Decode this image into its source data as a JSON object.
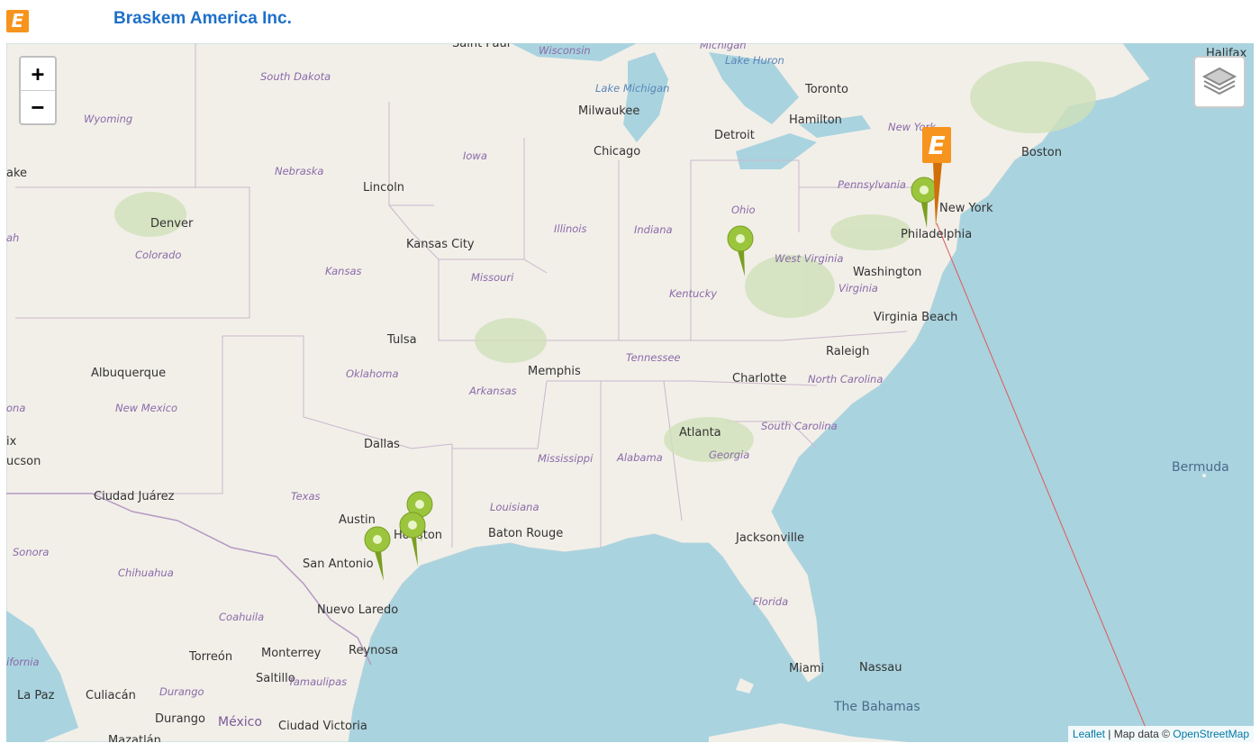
{
  "header": {
    "logo_letter": "E",
    "title": "Braskem America Inc."
  },
  "map": {
    "zoom_in": "+",
    "zoom_out": "−",
    "attribution": {
      "leaflet": "Leaflet",
      "separator": " | Map data © ",
      "osm": "OpenStreetMap"
    },
    "cities": [
      "Saint Paul",
      "Milwaukee",
      "Toronto",
      "Hamilton",
      "Detroit",
      "Chicago",
      "Halifax",
      "Boston",
      "New York",
      "Philadelphia",
      "Washington",
      "Virginia Beach",
      "Raleigh",
      "Charlotte",
      "Atlanta",
      "Jacksonville",
      "Miami",
      "Nassau",
      "Memphis",
      "Tulsa",
      "Kansas City",
      "Lincoln",
      "Denver",
      "Albuquerque",
      "Dallas",
      "Austin",
      "San Antonio",
      "Houston",
      "Baton Rouge",
      "Ciudad Juárez",
      "ucson",
      "ix",
      "ake",
      "Nuevo Laredo",
      "Reynosa",
      "Monterrey",
      "Saltillo",
      "Torreón",
      "Durango",
      "Culiacán",
      "La Paz",
      "Ciudad Victoria",
      "Mazatlán"
    ],
    "states": [
      "Wisconsin",
      "Michigan",
      "South Dakota",
      "Wyoming",
      "Nebraska",
      "Iowa",
      "Illinois",
      "Indiana",
      "Ohio",
      "Pennsylvania",
      "New York",
      "West Virginia",
      "Virginia",
      "Kentucky",
      "Colorado",
      "Kansas",
      "Missouri",
      "Oklahoma",
      "Tennessee",
      "Arkansas",
      "North Carolina",
      "South Carolina",
      "Georgia",
      "Alabama",
      "Mississippi",
      "Louisiana",
      "Texas",
      "New Mexico",
      "Florida",
      "Sonora",
      "Chihuahua",
      "Coahuila",
      "Durango",
      "Tamaulipas",
      "ifornia",
      "ah",
      "ona"
    ],
    "water_labels": [
      "Lake Michigan",
      "Lake Huron"
    ],
    "countries": [
      "México"
    ],
    "islands": [
      "Bermuda",
      "The Bahamas"
    ],
    "markers": [
      {
        "type": "pin",
        "location": "Philadelphia area"
      },
      {
        "type": "pin",
        "location": "Ohio"
      },
      {
        "type": "pin",
        "location": "Houston"
      },
      {
        "type": "pin",
        "location": "Houston"
      },
      {
        "type": "pin",
        "location": "Gulf Coast"
      },
      {
        "type": "headquarters",
        "location": "Pennsylvania"
      }
    ],
    "colors": {
      "pin": "#9bc53d",
      "hq": "#f7941d",
      "water": "#a9d3df",
      "land": "#f2efe9",
      "route": "#e0595a"
    }
  }
}
